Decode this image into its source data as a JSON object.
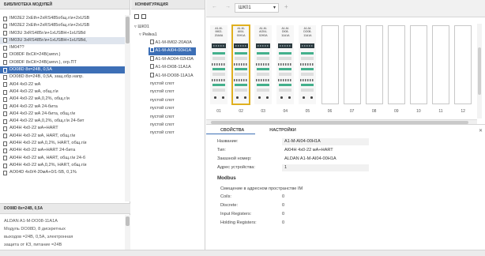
{
  "library": {
    "header": "БИБЛИОТЕКА МОДУЛЕЙ",
    "items": [
      "IM02E2 2xEth+2xRS485общ.г/и+2xUSB",
      "IM02E2 2xEth+2xRS485общ.г/и+2xUSB",
      "IM03U 3xRS485г/и+1xUSBH+1xUSBd",
      "IM03U 3xRS485г/и+1xUSBH+1xUSBd,",
      "IM04??",
      "DI08DF 8xСК=24В(зипл.)",
      "DI08DF 8xСК=24В(зипл.), огр.ПТ",
      "DO08D 8x=24В, 0,5А",
      "DO08D 8x=24В, 0,5А, защ.обр.напр.",
      "AI04 4x0-22 мА",
      "AI04 4x0-22 мА, общ.г/и",
      "AI04 4x0-22 мА,0,2%, общ.г/и",
      "AI04 4x0-22 мА 24-бита",
      "AI04 4x0-22 мА 24-бита, общ.г/и",
      "AI04 4x0-22 мА,0,2%, общ.г/и 24-бит",
      "AI04H 4x0-22 мА+HART",
      "AI04H 4x0-22 мА, HART, общ.г/и",
      "AI04H 4x0-22 мА,0,2%, HART, общ.г/и",
      "AI04H 4x0-22 мА+HART 24-бита",
      "AI04H 4x0-22 мА, HART, общ.г/и 24-б",
      "AI04H 4x0-22 мА,0,2%, HART, общ.г/и",
      "AO04D 4x0/4-20мА+0/1-5В, 0,1%"
    ],
    "selected_index": 7,
    "highlighted_index": 3,
    "desc_header": "DO08D 8x=24В, 0,5А",
    "desc_lines": [
      "ALDAN A1-M-DO08-11A1A",
      "Модуль DO08D, 8 дискретных",
      "выходов =24В, 0,5А, электронная",
      "защита от КЗ, питание =24В"
    ]
  },
  "config": {
    "header": "КОНФИГУРАЦИЯ",
    "station": "ШК01",
    "rack": "Рейка1",
    "modules": [
      "A1-M-IM02-20A0A",
      "A1-M-AI04-00H1A",
      "A1-M-AO04-02H3A",
      "A1-M-DI08-11A1A",
      "A1-M-DO08-11A1A"
    ],
    "selected_module": 1,
    "empty_slot_label": "пустой слот",
    "empty_slot_count": 7
  },
  "toolbar": {
    "back": "←",
    "forward": "→",
    "station_select": "ШК01",
    "add": "+"
  },
  "rack_view": {
    "slot_numbers": [
      "01",
      "02",
      "03",
      "04",
      "05",
      "06",
      "07",
      "08",
      "09",
      "10",
      "11",
      "12"
    ],
    "modules": [
      {
        "l1": "A1-M-",
        "l2": "IM02-",
        "l3": "20A0A"
      },
      {
        "l1": "A1-M-",
        "l2": "AI04-",
        "l3": "00H1A"
      },
      {
        "l1": "A1-M-",
        "l2": "AO04-",
        "l3": "02H3A"
      },
      {
        "l1": "A1-M-",
        "l2": "DI08-",
        "l3": "11A1A"
      },
      {
        "l1": "A1-M-",
        "l2": "DO08-",
        "l3": "11A1A"
      }
    ],
    "selected_slot": 1
  },
  "properties": {
    "tabs": [
      "СВОЙСТВА",
      "НАСТРОЙКИ"
    ],
    "active_tab": 0,
    "fields": [
      {
        "label": "Название:",
        "value": "A1-M-AI04-00H1A"
      },
      {
        "label": "Тип:",
        "value": "AI04H 4x0-22 мА+HART"
      },
      {
        "label": "Заказной номер:",
        "value": "ALDAN A1-M-AI04-00H1A"
      },
      {
        "label": "Адрес устройства:",
        "value": "1"
      }
    ],
    "modbus_title": "Modbus",
    "modbus_shift": "Смещение в адресном пространстве IM",
    "modbus_rows": [
      {
        "label": "Coils:",
        "value": "0"
      },
      {
        "label": "Discrete:",
        "value": "0"
      },
      {
        "label": "Input Registers:",
        "value": "0"
      },
      {
        "label": "Holding Registers:",
        "value": "0"
      }
    ]
  },
  "colors": {
    "selection": "#3d6fb6",
    "slot_highlight": "#e0b020",
    "terminal_green": "#44b08c"
  }
}
